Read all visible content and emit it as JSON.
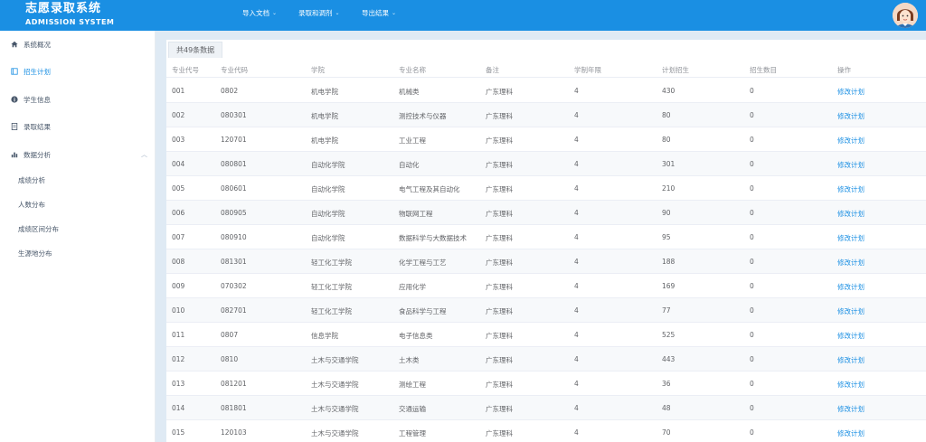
{
  "brand": {
    "title_cn": "志愿录取系统",
    "title_en": "ADMISSION SYSTEM"
  },
  "topnav": [
    {
      "label": "导入文档"
    },
    {
      "label": "录取和调剂"
    },
    {
      "label": "导出结果"
    }
  ],
  "sidebar": {
    "items": [
      {
        "label": "系统概况",
        "icon": "home-icon"
      },
      {
        "label": "招生计划",
        "icon": "book-icon"
      },
      {
        "label": "学生信息",
        "icon": "info-icon"
      },
      {
        "label": "录取结果",
        "icon": "document-icon"
      },
      {
        "label": "数据分析",
        "icon": "chart-icon"
      }
    ],
    "subitems": [
      {
        "label": "成绩分析"
      },
      {
        "label": "人数分布"
      },
      {
        "label": "成绩区间分布"
      },
      {
        "label": "生源地分布"
      }
    ]
  },
  "main": {
    "tab_label": "共49条数据",
    "columns": [
      "专业代号",
      "专业代码",
      "学院",
      "专业名称",
      "备注",
      "学制年限",
      "计划招生",
      "招生数目",
      "操作"
    ],
    "rows": [
      [
        "001",
        "0802",
        "机电学院",
        "机械类",
        "广东理科",
        "4",
        "430",
        "0",
        "修改计划"
      ],
      [
        "002",
        "080301",
        "机电学院",
        "测控技术与仪器",
        "广东理科",
        "4",
        "80",
        "0",
        "修改计划"
      ],
      [
        "003",
        "120701",
        "机电学院",
        "工业工程",
        "广东理科",
        "4",
        "80",
        "0",
        "修改计划"
      ],
      [
        "004",
        "080801",
        "自动化学院",
        "自动化",
        "广东理科",
        "4",
        "301",
        "0",
        "修改计划"
      ],
      [
        "005",
        "080601",
        "自动化学院",
        "电气工程及其自动化",
        "广东理科",
        "4",
        "210",
        "0",
        "修改计划"
      ],
      [
        "006",
        "080905",
        "自动化学院",
        "物联网工程",
        "广东理科",
        "4",
        "90",
        "0",
        "修改计划"
      ],
      [
        "007",
        "080910",
        "自动化学院",
        "数据科学与大数据技术",
        "广东理科",
        "4",
        "95",
        "0",
        "修改计划"
      ],
      [
        "008",
        "081301",
        "轻工化工学院",
        "化学工程与工艺",
        "广东理科",
        "4",
        "188",
        "0",
        "修改计划"
      ],
      [
        "009",
        "070302",
        "轻工化工学院",
        "应用化学",
        "广东理科",
        "4",
        "169",
        "0",
        "修改计划"
      ],
      [
        "010",
        "082701",
        "轻工化工学院",
        "食品科学与工程",
        "广东理科",
        "4",
        "77",
        "0",
        "修改计划"
      ],
      [
        "011",
        "0807",
        "信息学院",
        "电子信息类",
        "广东理科",
        "4",
        "525",
        "0",
        "修改计划"
      ],
      [
        "012",
        "0810",
        "土木与交通学院",
        "土木类",
        "广东理科",
        "4",
        "443",
        "0",
        "修改计划"
      ],
      [
        "013",
        "081201",
        "土木与交通学院",
        "测绘工程",
        "广东理科",
        "4",
        "36",
        "0",
        "修改计划"
      ],
      [
        "014",
        "081801",
        "土木与交通学院",
        "交通运输",
        "广东理科",
        "4",
        "48",
        "0",
        "修改计划"
      ],
      [
        "015",
        "120103",
        "土木与交通学院",
        "工程管理",
        "广东理科",
        "4",
        "70",
        "0",
        "修改计划"
      ]
    ]
  },
  "colors": {
    "topbar": "#1a8fe3",
    "active": "#1a8fe3",
    "link": "#1a8fe3"
  }
}
